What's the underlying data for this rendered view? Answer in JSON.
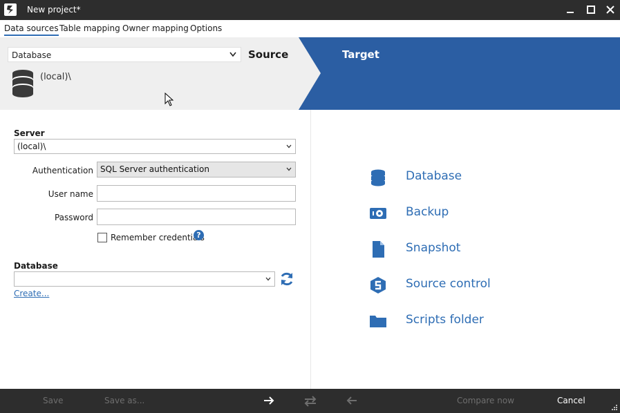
{
  "window": {
    "title": "New project*"
  },
  "tabs": [
    {
      "label": "Data sources",
      "active": true
    },
    {
      "label": "Table mapping",
      "active": false
    },
    {
      "label": "Owner mapping",
      "active": false
    },
    {
      "label": "Options",
      "active": false
    }
  ],
  "source": {
    "type_selected": "Database",
    "heading": "Source",
    "server_display": "(local)\\"
  },
  "target": {
    "heading": "Target",
    "options": [
      {
        "label": "Database",
        "icon": "database-icon"
      },
      {
        "label": "Backup",
        "icon": "backup-icon"
      },
      {
        "label": "Snapshot",
        "icon": "snapshot-icon"
      },
      {
        "label": "Source control",
        "icon": "source-control-icon"
      },
      {
        "label": "Scripts folder",
        "icon": "folder-icon"
      }
    ]
  },
  "form": {
    "server_label": "Server",
    "server_value": "(local)\\",
    "auth_label": "Authentication",
    "auth_value": "SQL Server authentication",
    "username_label": "User name",
    "username_value": "",
    "password_label": "Password",
    "password_value": "",
    "remember_label": "Remember credentials",
    "remember_checked": false,
    "help_glyph": "?",
    "database_label": "Database",
    "database_value": "",
    "create_link": "Create..."
  },
  "footer": {
    "save": "Save",
    "save_as": "Save as...",
    "compare_now": "Compare now",
    "cancel": "Cancel"
  },
  "colors": {
    "accent": "#2e6db4",
    "target_band": "#2b5ea3",
    "titlebar": "#2d2d2d",
    "header_bg": "#efefef"
  }
}
